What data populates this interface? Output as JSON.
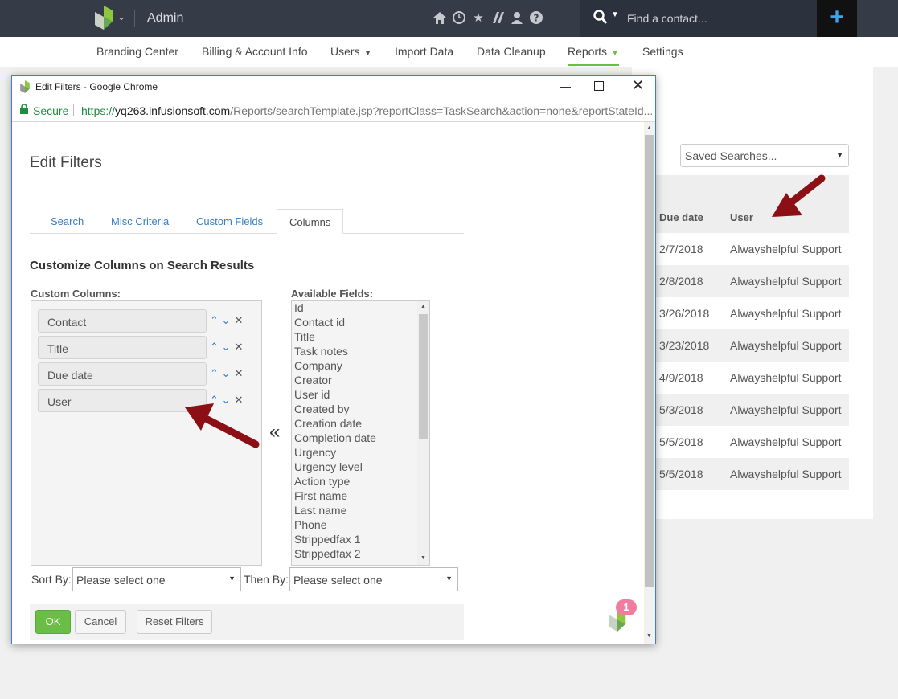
{
  "topbar": {
    "app_title": "Admin",
    "search_placeholder": "Find a contact...",
    "plus_label": "+"
  },
  "nav": {
    "items": [
      {
        "label": "Branding Center"
      },
      {
        "label": "Billing & Account Info"
      },
      {
        "label": "Users"
      },
      {
        "label": "Import Data"
      },
      {
        "label": "Data Cleanup"
      },
      {
        "label": "Reports"
      },
      {
        "label": "Settings"
      }
    ],
    "active": "Reports"
  },
  "background_page": {
    "saved_searches": "Saved Searches...",
    "columns": [
      "Due date",
      "User"
    ],
    "rows": [
      {
        "due": "2/7/2018",
        "user": "Alwayshelpful Support"
      },
      {
        "due": "2/8/2018",
        "user": "Alwayshelpful Support"
      },
      {
        "due": "3/26/2018",
        "user": "Alwayshelpful Support"
      },
      {
        "due": "3/23/2018",
        "user": "Alwayshelpful Support"
      },
      {
        "due": "4/9/2018",
        "user": "Alwayshelpful Support"
      },
      {
        "due": "5/3/2018",
        "user": "Alwayshelpful Support"
      },
      {
        "due": "5/5/2018",
        "user": "Alwayshelpful Support"
      },
      {
        "due": "5/5/2018",
        "user": "Alwayshelpful Support"
      }
    ]
  },
  "popup": {
    "window_title": "Edit Filters - Google Chrome",
    "secure_label": "Secure",
    "url_scheme": "https://",
    "url_host": "yq263.infusionsoft.com",
    "url_path": "/Reports/searchTemplate.jsp?reportClass=TaskSearch&action=none&reportStateId...",
    "page_title": "Edit Filters",
    "tabs": [
      {
        "label": "Search"
      },
      {
        "label": "Misc Criteria"
      },
      {
        "label": "Custom Fields"
      },
      {
        "label": "Columns"
      }
    ],
    "active_tab": "Columns",
    "section_title": "Customize Columns on Search Results",
    "custom_columns_label": "Custom Columns:",
    "available_fields_label": "Available Fields:",
    "custom_columns": [
      "Contact",
      "Title",
      "Due date",
      "User"
    ],
    "available_fields": [
      "Id",
      "Contact id",
      "Title",
      "Task notes",
      "Company",
      "Creator",
      "User id",
      "Created by",
      "Creation date",
      "Completion date",
      "Urgency",
      "Urgency level",
      "Action type",
      "First name",
      "Last name",
      "Phone",
      "Strippedfax 1",
      "Strippedfax 2"
    ],
    "move_left_glyph": "«",
    "sort_by_label": "Sort By:",
    "then_by_label": "Then By:",
    "sort_by_value": "Please select one",
    "then_by_value": "Please select one",
    "ok_label": "OK",
    "cancel_label": "Cancel",
    "reset_label": "Reset Filters",
    "notification_count": "1"
  },
  "colors": {
    "topbar_bg": "#353c48",
    "accent_green": "#6abe45",
    "link_blue": "#3a7fc2",
    "annotation_arrow": "#8b0f14",
    "badge_pink": "#f07ca0"
  }
}
